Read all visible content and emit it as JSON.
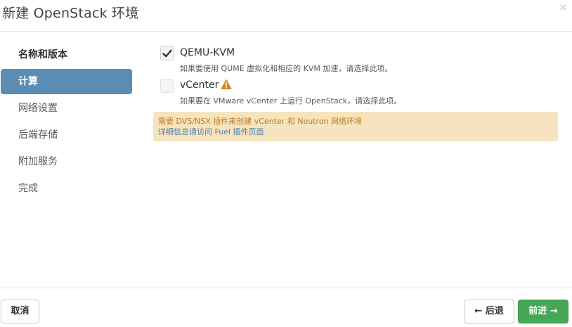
{
  "dialog": {
    "title": "新建 OpenStack 环境",
    "close_symbol": "×"
  },
  "sidebar": {
    "items": [
      {
        "label": "名称和版本",
        "state": "done"
      },
      {
        "label": "计算",
        "state": "active"
      },
      {
        "label": "网络设置",
        "state": "pending"
      },
      {
        "label": "后端存储",
        "state": "pending"
      },
      {
        "label": "附加服务",
        "state": "pending"
      },
      {
        "label": "完成",
        "state": "pending"
      }
    ]
  },
  "compute": {
    "options": [
      {
        "label": "QEMU-KVM",
        "description": "如果要使用 QUME 虚拟化和相应的 KVM 加速，请选择此项。",
        "checked": true,
        "disabled": false
      },
      {
        "label": "vCenter",
        "description": "如果要在 VMware vCenter 上运行 OpenStack，请选择此项。",
        "checked": false,
        "disabled": true,
        "warning_icon": "warning-icon"
      }
    ],
    "alert": {
      "message": "需要 DVS/NSX 插件来创建 vCenter 和 Neutron 网络环境",
      "link_text": "详细信息请访问 Fuel 插件页面"
    }
  },
  "footer": {
    "cancel_label": "取消",
    "back_label": "后退",
    "back_icon": "←",
    "next_label": "前进",
    "next_icon": "→"
  },
  "colors": {
    "active_nav": "#5b8cb3",
    "next_button": "#47a757",
    "alert_bg": "#f5e4bd",
    "alert_text": "#c07a1d",
    "alert_link": "#4d7fa9",
    "warning_icon": "#d08a22"
  }
}
